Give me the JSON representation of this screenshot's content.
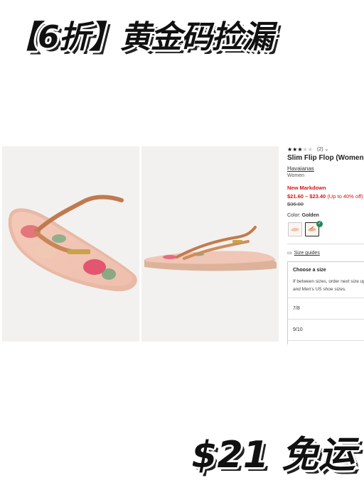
{
  "banner": {
    "title": "【6折】黄金码捡漏",
    "price_tag": "$21 免运"
  },
  "product": {
    "rating_count": "(2)",
    "title": "Slim Flip Flop (Women)",
    "brand": "Havaianas",
    "gender": "Women",
    "markdown_label": "New Markdown",
    "sale_price": "$21.60 – $23.40",
    "sale_off": "(Up to 40% off)",
    "original_price": "$36.00",
    "color_label": "Color:",
    "color_value": "Golden",
    "size_guides": "Size guides",
    "choose_size": "Choose a size",
    "size_help": "If between sizes, order next size up. EU, and Men's US shoe sizes.",
    "sizes": [
      "7/8",
      "9/10"
    ]
  },
  "colors": {
    "sale_red": "#d11111",
    "check_green": "#1f8a50"
  },
  "rating": {
    "value": 3,
    "max": 5
  }
}
